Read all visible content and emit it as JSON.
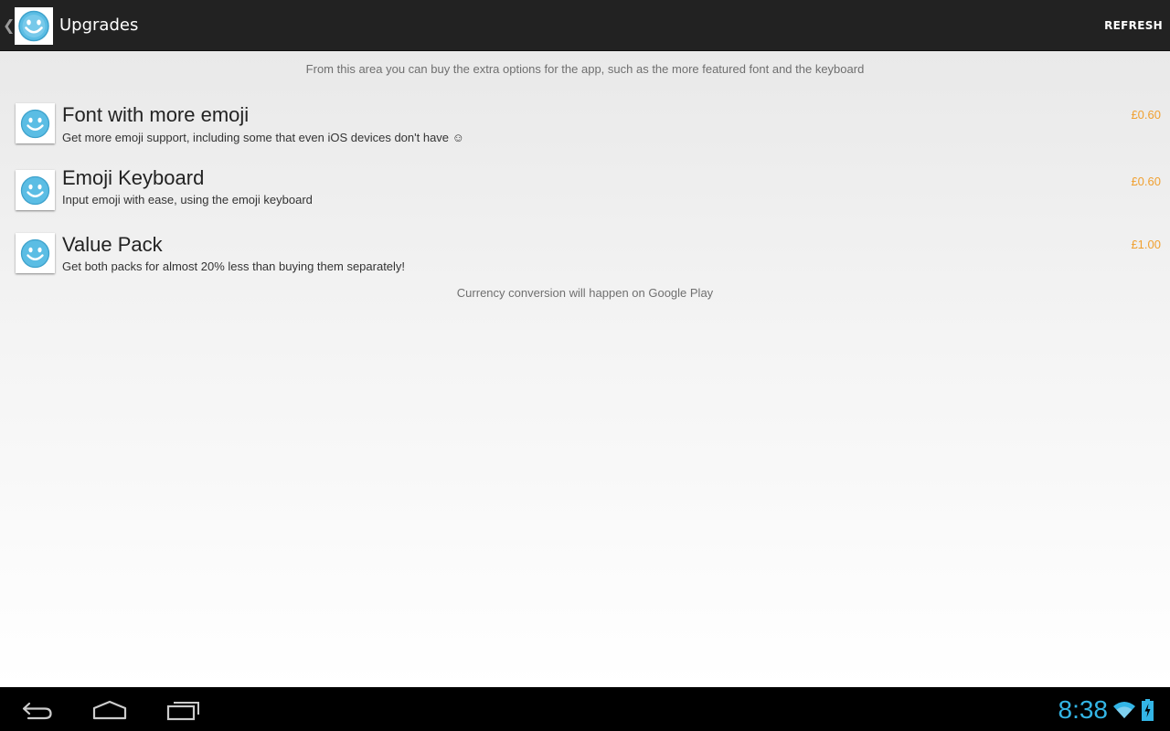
{
  "actionbar": {
    "title": "Upgrades",
    "refresh_label": "REFRESH",
    "up_caret": "❮"
  },
  "content": {
    "intro": "From this area you can buy the extra options for the app, such as the more featured font and the keyboard",
    "items": [
      {
        "title": "Font with more emoji",
        "description": "Get more emoji support, including some that even iOS devices don't have ☺",
        "price": "£0.60"
      },
      {
        "title": "Emoji Keyboard",
        "description": "Input emoji with ease, using the emoji keyboard",
        "price": "£0.60"
      },
      {
        "title": "Value Pack",
        "description": "Get both packs for almost 20% less than buying them separately!",
        "price": "£1.00"
      }
    ],
    "footer_note": "Currency conversion will happen on Google Play"
  },
  "systembar": {
    "clock": "8:38",
    "icons": [
      "back-icon",
      "home-icon",
      "recent-apps-icon",
      "wifi-icon",
      "battery-charging-icon"
    ]
  },
  "colors": {
    "accent": "#33b5e5",
    "price": "#f0a030",
    "actionbar": "#222222",
    "smiley": "#5bbde4"
  }
}
